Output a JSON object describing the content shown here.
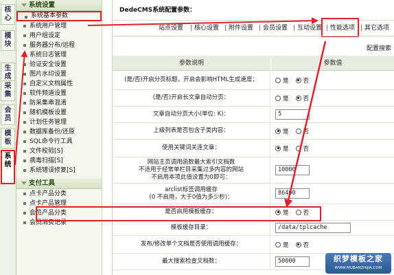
{
  "left_tabs": [
    "核心",
    "模块",
    "生成",
    "采集",
    "会员",
    "模板",
    "系统"
  ],
  "menu": {
    "section1": "系统设置",
    "items1": [
      "系统基本参数",
      "系统用户管理",
      "用户组设定",
      "服务器分布/远程",
      "系统日志管理",
      "验证安全设置",
      "图片水印设置",
      "自定义文档属性",
      "软件频道设置",
      "防采集串混淆",
      "随机模板设置",
      "计划任务管理",
      "数据库备份/还原",
      "SQL命令行工具",
      "文件校验[S]",
      "病毒扫描[S]",
      "系统错误修复[S]"
    ],
    "section2": "支付工具",
    "items2": [
      "点卡产品分类",
      "点卡产品管理",
      "会员产品分类",
      "会员消费记录"
    ]
  },
  "header": {
    "title": "DedeCMS系统配置参数："
  },
  "nav_tabs": [
    "站点设置",
    "核心设置",
    "附件设置",
    "会员设置",
    "互动设置",
    "性能选项",
    "其它选项"
  ],
  "search_label": "配置搜索",
  "table": {
    "col1": "参数说明",
    "col2": "参数值",
    "yes": "是",
    "no": "否",
    "rows": [
      {
        "label": "(是/否)开启分页标题，开启会影响HTML生成速度：",
        "type": "radio",
        "value": "no"
      },
      {
        "label": "(是/否)开启长文章自动分页：",
        "type": "radio",
        "value": "no"
      },
      {
        "label": "文章自动分页大小(单位: K)：",
        "type": "text",
        "value": "5"
      },
      {
        "label": "上级列表是否包含子类内容：",
        "type": "radio",
        "value": "yes"
      },
      {
        "label": "使用关键词关连文章：",
        "type": "radio",
        "value": "yes"
      },
      {
        "label": "网站主页调用函数最大索引文档数\n不适用于经常单栏目采集过多内容的网站\n不启用本项此值设置为0即可：",
        "type": "text",
        "value": "10000"
      },
      {
        "label": "arclist标签调用缓存\n(0 不启用，大于0值为多少秒)：",
        "type": "text",
        "value": "86400"
      },
      {
        "label": "是否启用模板缓存：",
        "type": "radio",
        "value": "yes"
      },
      {
        "label": "模板缓存目录：",
        "type": "text",
        "value": "/data/tplcache"
      },
      {
        "label": "发布/修改单个文档是否使用调用缓存：",
        "type": "radio",
        "value": "no"
      },
      {
        "label": "最大搜索检查文档数：",
        "type": "text",
        "value": "50000"
      }
    ]
  },
  "watermark": {
    "line1": "织梦模板之家",
    "line2": "WWW.MUBANZHIJIA.COM"
  },
  "colors": {
    "highlight": "#e0202a",
    "menu_bg": "#f4f8ef",
    "header_bg": "#e6ede0"
  }
}
